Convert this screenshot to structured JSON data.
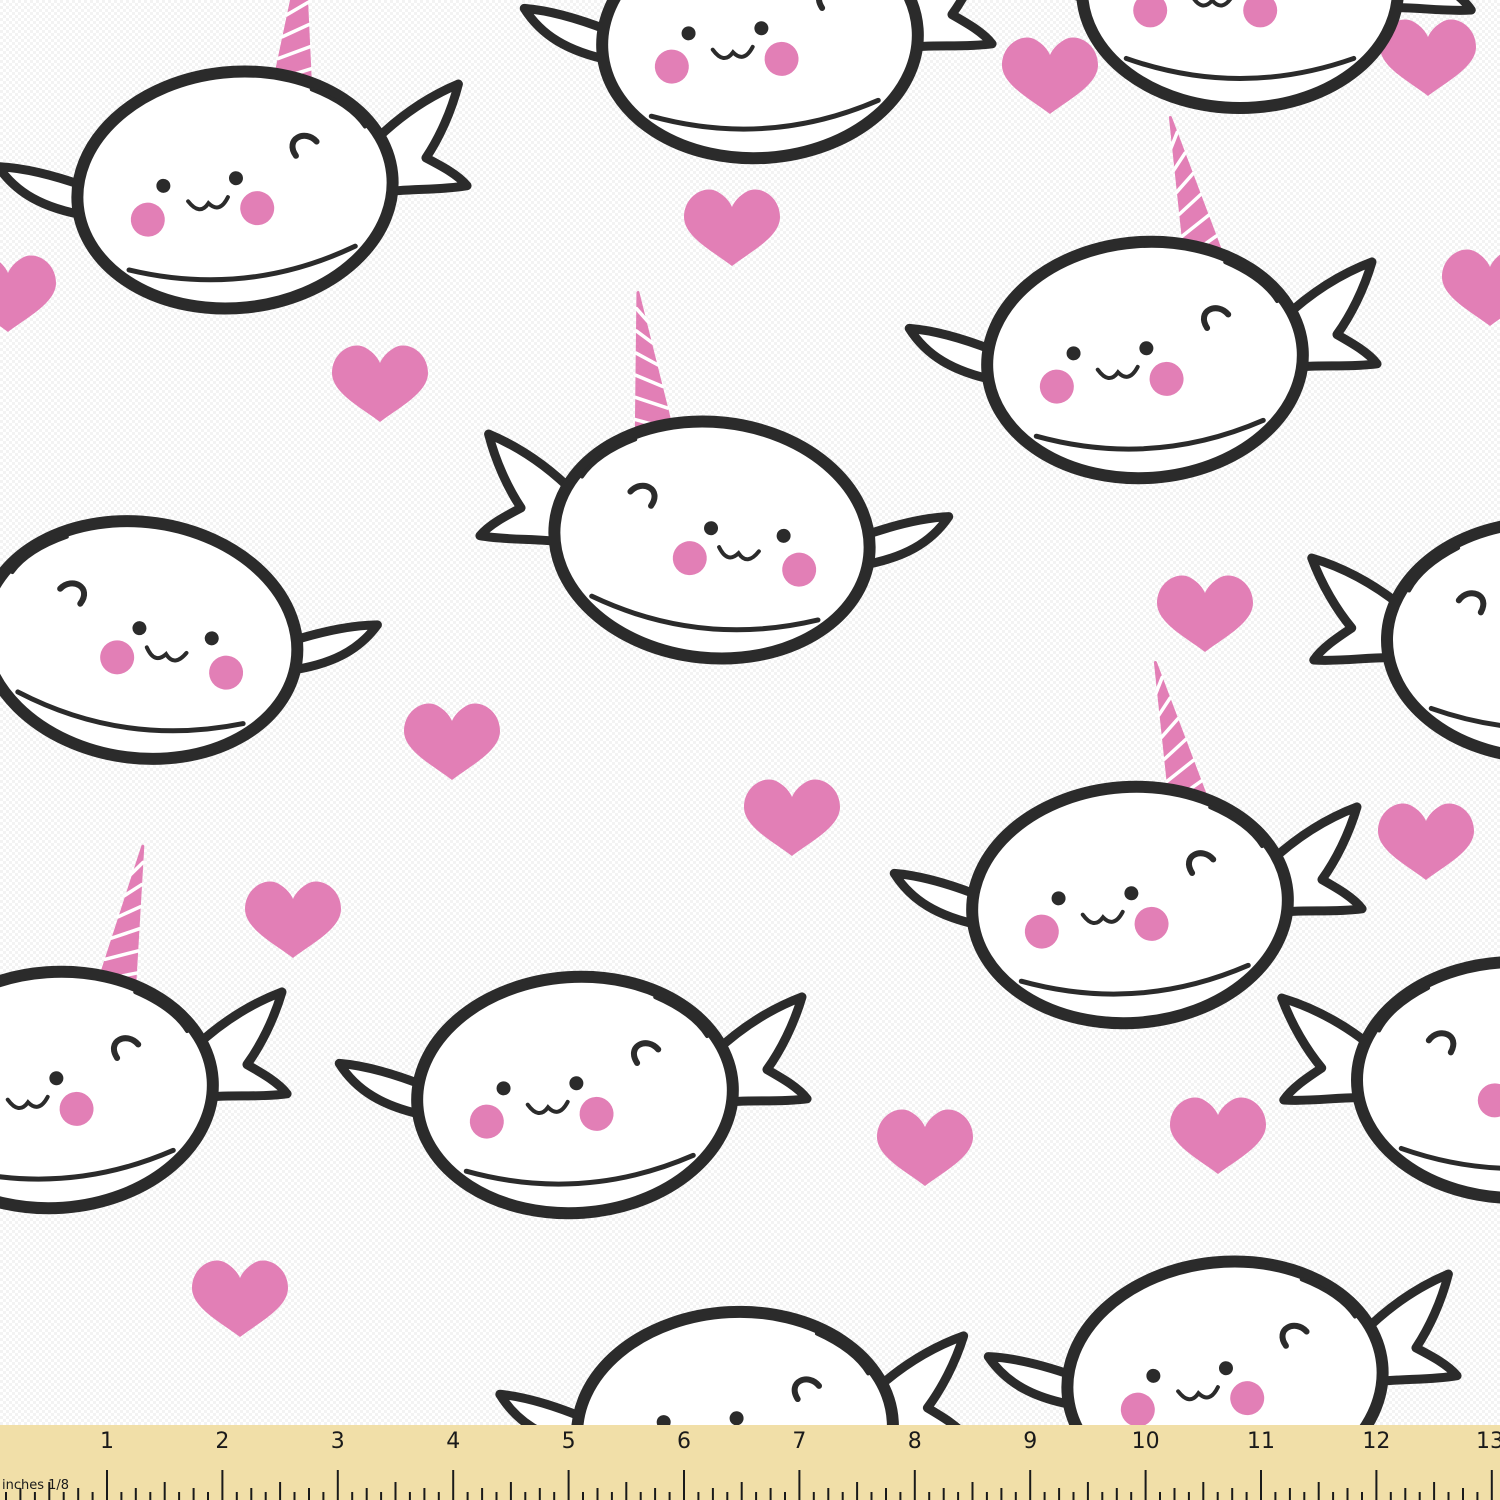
{
  "colors": {
    "background": "#ffffff",
    "outline": "#2b2b2b",
    "pink": "#e27fb6",
    "horn_stripe": "#ffffff",
    "ruler": "#f1dfa8",
    "ruler_ink": "#1a1a1a"
  },
  "pattern": {
    "motifs": [
      "narwhal-icon",
      "heart-icon"
    ]
  },
  "ruler": {
    "unit_label": "inches 1/8",
    "numbers": [
      "1",
      "2",
      "3",
      "4",
      "5",
      "6",
      "7",
      "8",
      "9",
      "10",
      "11",
      "12",
      "13"
    ]
  }
}
